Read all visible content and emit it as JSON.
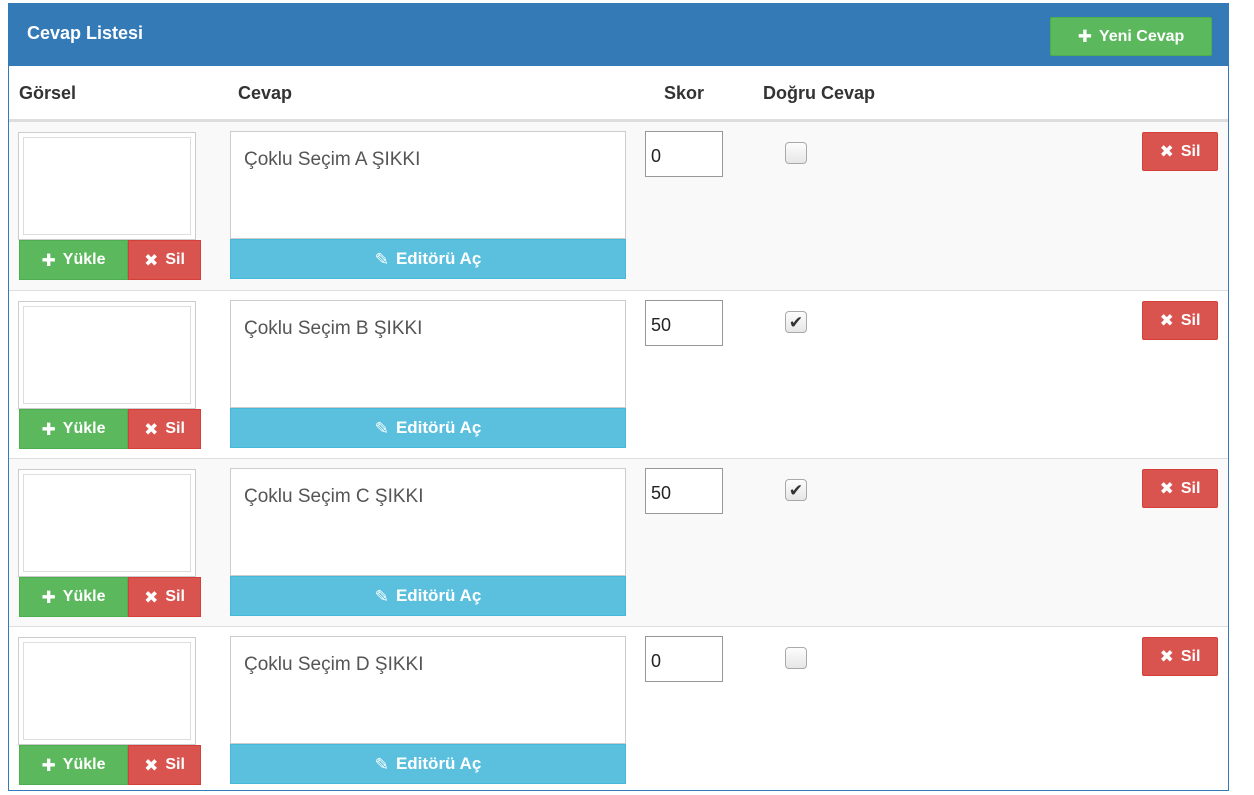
{
  "panel": {
    "title": "Cevap Listesi",
    "new_button_label": "Yeni Cevap"
  },
  "columns": {
    "image": "Görsel",
    "answer": "Cevap",
    "score": "Skor",
    "correct": "Doğru Cevap"
  },
  "labels": {
    "upload": "Yükle",
    "delete": "Sil",
    "open_editor": "Editörü Aç"
  },
  "rows": [
    {
      "answer": "Çoklu Seçim A ŞIKKI",
      "score": "0",
      "correct": false
    },
    {
      "answer": "Çoklu Seçim B ŞIKKI",
      "score": "50",
      "correct": true
    },
    {
      "answer": "Çoklu Seçim C ŞIKKI",
      "score": "50",
      "correct": true
    },
    {
      "answer": "Çoklu Seçim D ŞIKKI",
      "score": "0",
      "correct": false
    }
  ],
  "icons": {
    "plus": "plus-icon",
    "remove": "remove-icon",
    "pencil": "pencil-icon",
    "check": "checkmark-icon"
  },
  "colors": {
    "primary": "#337ab7",
    "success": "#5cb85c",
    "danger": "#d9534f",
    "info": "#5bc0de"
  }
}
